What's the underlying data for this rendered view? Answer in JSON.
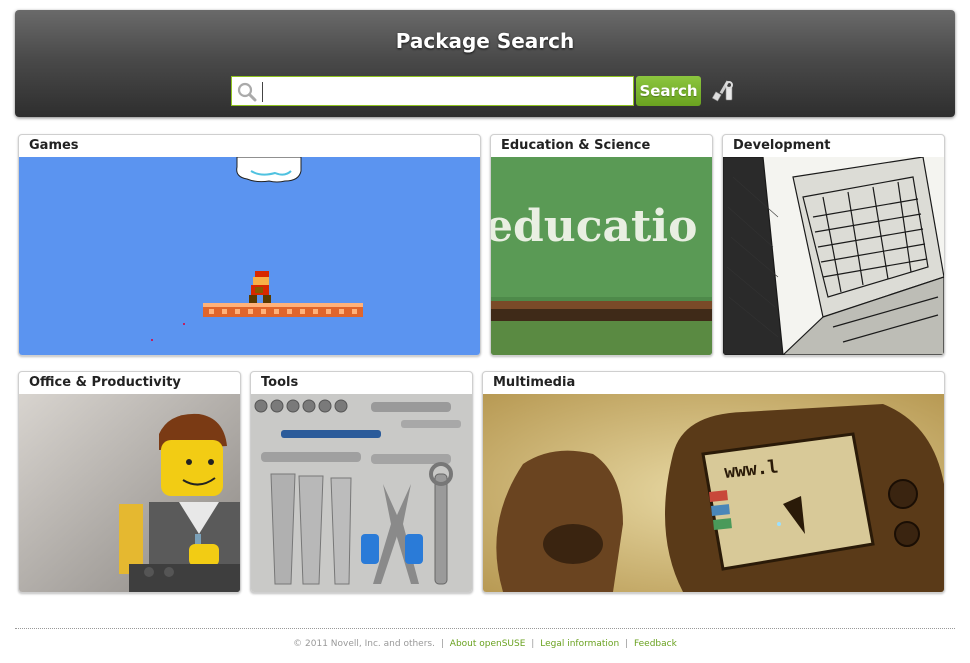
{
  "header": {
    "title": "Package Search",
    "search_placeholder": "",
    "search_value": "",
    "search_button_label": "Search",
    "search_icon": "magnifier-icon",
    "tools_icon": "wrench-screwdriver-icon"
  },
  "categories": [
    {
      "label": "Games",
      "image": "retro-platformer-scene"
    },
    {
      "label": "Education & Science",
      "image": "chalkboard-education"
    },
    {
      "label": "Development",
      "image": "sketched-laptop"
    },
    {
      "label": "Office & Productivity",
      "image": "lego-office-worker"
    },
    {
      "label": "Tools",
      "image": "hand-tools-layout"
    },
    {
      "label": "Multimedia",
      "image": "retro-monitor-drawing"
    }
  ],
  "footer": {
    "copyright": "© 2011 Novell, Inc. and others.",
    "links": [
      "About openSUSE",
      "Legal information",
      "Feedback"
    ],
    "separator": "|"
  },
  "colors": {
    "accent": "#6aa220",
    "header_dark": "#2e2e2e",
    "header_light": "#6a6a6a"
  }
}
